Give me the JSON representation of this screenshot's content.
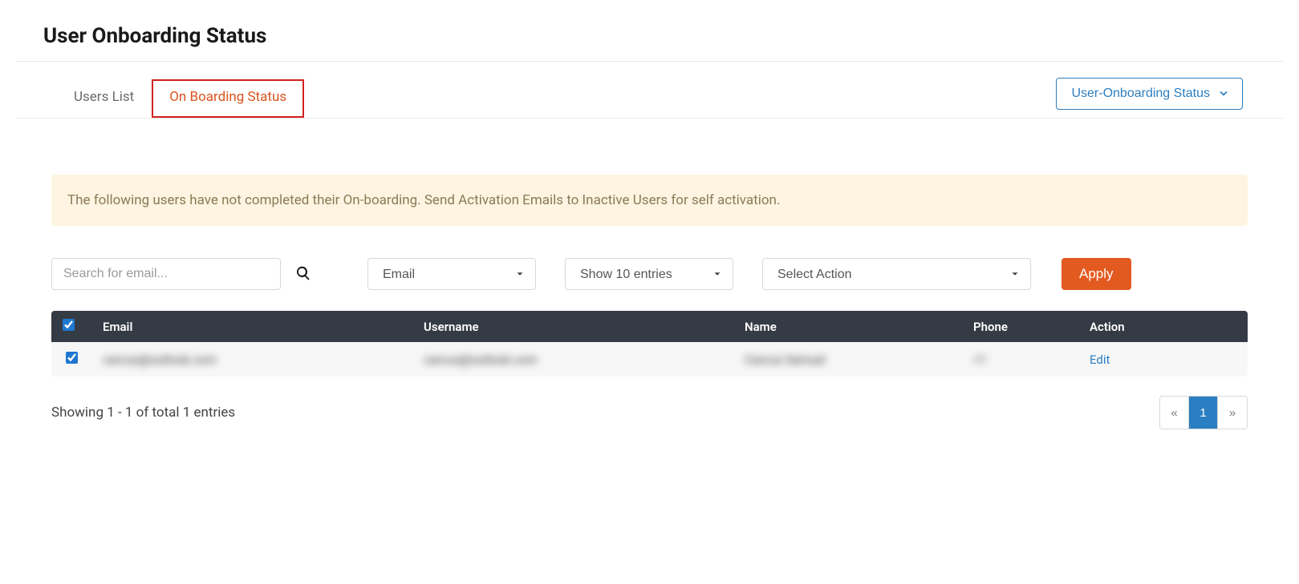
{
  "page_title": "User Onboarding Status",
  "tabs": [
    {
      "label": "Users List",
      "active": false
    },
    {
      "label": "On Boarding Status",
      "active": true
    }
  ],
  "header_dropdown": {
    "label": "User-Onboarding Status"
  },
  "info_banner": "The following users have not completed their On-boarding. Send Activation Emails to Inactive Users for self activation.",
  "search": {
    "placeholder": "Search for email..."
  },
  "filters": {
    "column_select": "Email",
    "entries_select": "Show 10 entries",
    "action_select": "Select Action",
    "apply_label": "Apply"
  },
  "table": {
    "headers": {
      "email": "Email",
      "username": "Username",
      "name": "Name",
      "phone": "Phone",
      "action": "Action"
    },
    "rows": [
      {
        "checked": true,
        "email": "carcus@outlook.com",
        "username": "carcus@outlook.com",
        "name": "Carcus Samuel",
        "phone": "+1",
        "action": "Edit"
      }
    ]
  },
  "footer": {
    "showing_text": "Showing 1 - 1 of total 1 entries",
    "pages": {
      "prev": "«",
      "current": "1",
      "next": "»"
    }
  }
}
